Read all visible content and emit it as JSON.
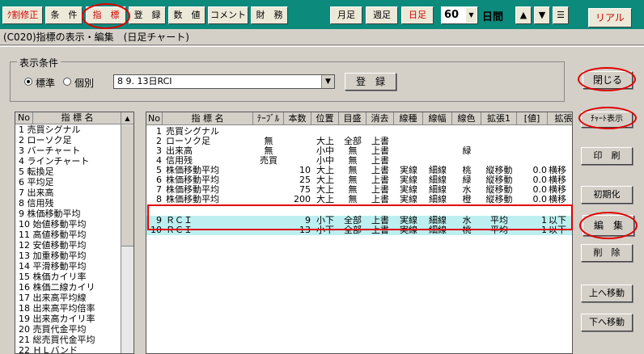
{
  "toolbar": {
    "items": [
      "ｸ割修正",
      "条　件",
      "指　標",
      "登　録",
      "数　値",
      "コメント",
      "財　務"
    ],
    "periods": [
      "月足",
      "週足",
      "日足"
    ],
    "count": "60",
    "unit": "日間",
    "up": "▲",
    "down": "▼",
    "menu": "☰",
    "realtime": "リアル"
  },
  "window_title": "(C020)指標の表示・編集　(日足チャート)",
  "conditions": {
    "legend": "表示条件",
    "radio_standard": "標準",
    "radio_individual": "個別",
    "preset_value": "8 9. 13日RCI",
    "register_button": "登　録"
  },
  "buttons": {
    "close": "閉じる",
    "chart_display": "ﾁｬｰﾄ表示",
    "print": "印　刷",
    "initialize": "初期化",
    "edit": "編　集",
    "delete": "削　除",
    "move_up": "上へ移動",
    "move_down": "下へ移動"
  },
  "left_list": {
    "headers": [
      "No",
      "指 標 名"
    ],
    "items": [
      "1 売買シグナル",
      "2 ローソク足",
      "3 バーチャート",
      "4 ラインチャート",
      "5 転換足",
      "6 平均足",
      "7 出来高",
      "8 信用残",
      "9 株価移動平均",
      "10 始値移動平均",
      "11 高値移動平均",
      "12 安値移動平均",
      "13 加重移動平均",
      "14 平滑移動平均",
      "15 株価カイリ率",
      "16 株価二線カイリ",
      "17 出来高平均線",
      "18 出来高平均倍率",
      "19 出来高カイリ率",
      "20 売買代金平均",
      "21 総売買代金平均",
      "22 ＨＬバンド"
    ]
  },
  "grid": {
    "headers": [
      "No",
      "指 標 名",
      "ﾃｰﾌﾞﾙ",
      "本数",
      "位置",
      "目盛",
      "消去",
      "線種",
      "線幅",
      "線色",
      "拡張1",
      "[値]",
      "拡張"
    ],
    "rows": [
      [
        "1",
        "売買シグナル",
        "",
        "",
        "",
        "",
        "",
        "",
        "",
        "",
        "",
        "",
        ""
      ],
      [
        "2",
        "ローソク足",
        "無",
        "",
        "大上",
        "全部",
        "上書",
        "",
        "",
        "",
        "",
        "",
        ""
      ],
      [
        "3",
        "出来高",
        "無",
        "",
        "小中",
        "無",
        "上書",
        "",
        "",
        "緑",
        "",
        "",
        ""
      ],
      [
        "4",
        "信用残",
        "売買",
        "",
        "小中",
        "無",
        "上書",
        "",
        "",
        "",
        "",
        "",
        ""
      ],
      [
        "5",
        "株価移動平均",
        "",
        "10",
        "大上",
        "無",
        "上書",
        "実線",
        "細線",
        "桃",
        "縦移動",
        "0.0",
        "横移"
      ],
      [
        "6",
        "株価移動平均",
        "",
        "25",
        "大上",
        "無",
        "上書",
        "実線",
        "細線",
        "緑",
        "縦移動",
        "0.0",
        "横移"
      ],
      [
        "7",
        "株価移動平均",
        "",
        "75",
        "大上",
        "無",
        "上書",
        "実線",
        "細線",
        "水",
        "縦移動",
        "0.0",
        "横移"
      ],
      [
        "8",
        "株価移動平均",
        "",
        "200",
        "大上",
        "無",
        "上書",
        "実線",
        "細線",
        "橙",
        "縦移動",
        "0.0",
        "横移"
      ],
      [
        "9",
        "ＲＣＩ",
        "",
        "9",
        "小下",
        "全部",
        "上書",
        "実線",
        "細線",
        "水",
        "平均",
        "1",
        "以下"
      ],
      [
        "10",
        "ＲＣＩ",
        "",
        "13",
        "小下",
        "全部",
        "上書",
        "実線",
        "細線",
        "桃",
        "平均",
        "1",
        "以下"
      ]
    ]
  }
}
